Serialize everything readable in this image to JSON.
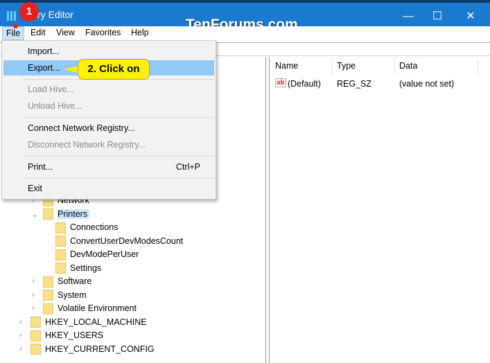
{
  "window": {
    "title": "Registry Editor",
    "title_visible": "istry Editor",
    "watermark": "TenForums.com",
    "minimize": "—",
    "maximize": "☐",
    "close": "✕"
  },
  "menubar": [
    "File",
    "Edit",
    "View",
    "Favorites",
    "Help"
  ],
  "file_menu": {
    "items": [
      {
        "label": "Import...",
        "enabled": true
      },
      {
        "label": "Export...",
        "enabled": true,
        "highlighted": true
      },
      {
        "label": "Load Hive...",
        "enabled": false
      },
      {
        "label": "Unload Hive...",
        "enabled": false
      },
      {
        "label": "Connect Network Registry...",
        "enabled": true
      },
      {
        "label": "Disconnect Network Registry...",
        "enabled": false
      },
      {
        "label": "Print...",
        "shortcut": "Ctrl+P",
        "enabled": true
      },
      {
        "label": "Exit",
        "enabled": true
      }
    ]
  },
  "annotations": {
    "step1": "1",
    "step2": "2. Click on"
  },
  "tree": [
    {
      "label": "Network",
      "level": 2,
      "expander": "collapsed"
    },
    {
      "label": "Printers",
      "level": 2,
      "expander": "expanded",
      "selected": true
    },
    {
      "label": "Connections",
      "level": 3
    },
    {
      "label": "ConvertUserDevModesCount",
      "level": 3
    },
    {
      "label": "DevModePerUser",
      "level": 3
    },
    {
      "label": "Settings",
      "level": 3
    },
    {
      "label": "Software",
      "level": 2,
      "expander": "collapsed"
    },
    {
      "label": "System",
      "level": 2,
      "expander": "collapsed"
    },
    {
      "label": "Volatile Environment",
      "level": 2,
      "expander": "collapsed"
    },
    {
      "label": "HKEY_LOCAL_MACHINE",
      "level": 1,
      "expander": "collapsed"
    },
    {
      "label": "HKEY_USERS",
      "level": 1,
      "expander": "collapsed"
    },
    {
      "label": "HKEY_CURRENT_CONFIG",
      "level": 1,
      "expander": "collapsed"
    }
  ],
  "values": {
    "columns": [
      "Name",
      "Type",
      "Data"
    ],
    "rows": [
      {
        "name": "(Default)",
        "type": "REG_SZ",
        "data": "(value not set)",
        "icon": "string-value-icon"
      }
    ]
  }
}
